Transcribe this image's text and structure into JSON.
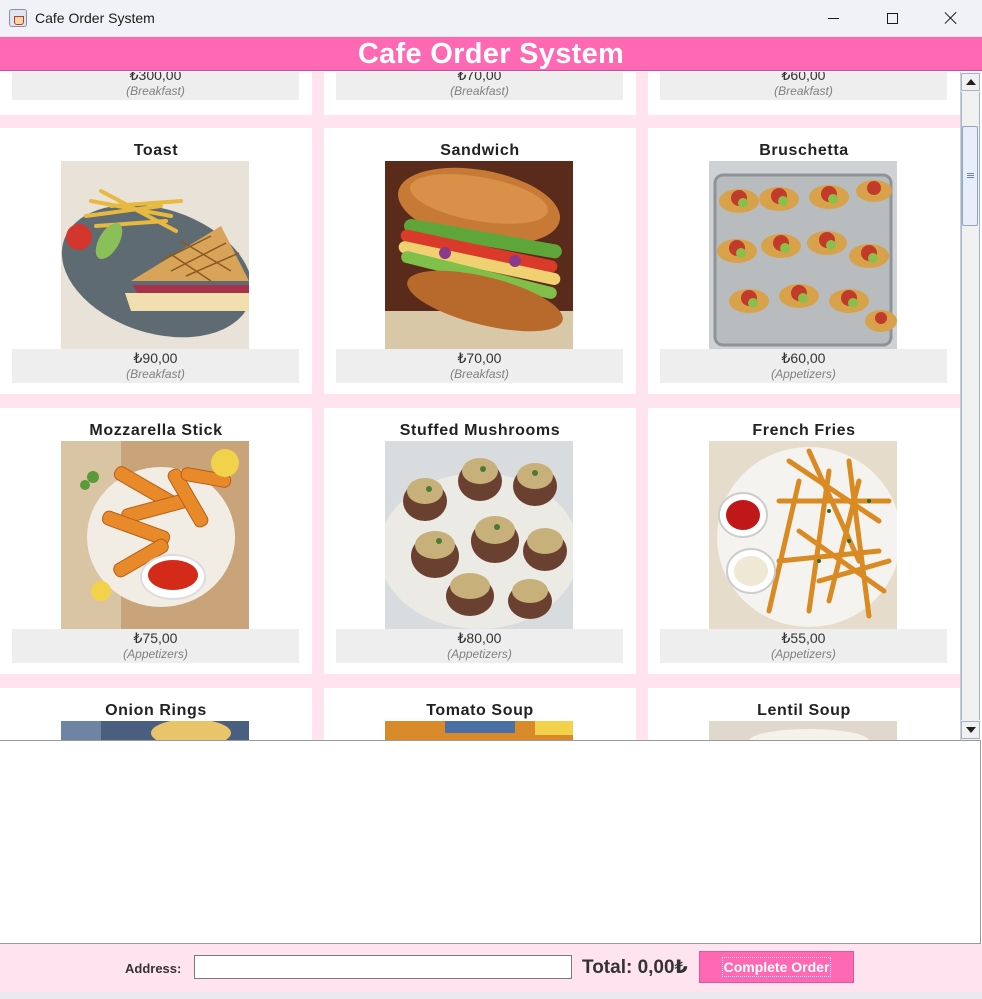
{
  "window": {
    "title": "Cafe Order System",
    "controls": [
      "minimize",
      "maximize",
      "close"
    ]
  },
  "header": {
    "title": "Cafe Order System"
  },
  "menu": {
    "rows": [
      {
        "items": [
          {
            "price": "₺300,00",
            "category": "(Breakfast)"
          },
          {
            "price": "₺70,00",
            "category": "(Breakfast)"
          },
          {
            "price": "₺60,00",
            "category": "(Breakfast)"
          }
        ]
      },
      {
        "items": [
          {
            "name": "Toast",
            "price": "₺90,00",
            "category": "(Breakfast)",
            "image": "toast-photo"
          },
          {
            "name": "Sandwich",
            "price": "₺70,00",
            "category": "(Breakfast)",
            "image": "sandwich-photo"
          },
          {
            "name": "Bruschetta",
            "price": "₺60,00",
            "category": "(Appetizers)",
            "image": "bruschetta-photo"
          }
        ]
      },
      {
        "items": [
          {
            "name": "Mozzarella Stick",
            "price": "₺75,00",
            "category": "(Appetizers)",
            "image": "mozzarella-sticks-photo"
          },
          {
            "name": "Stuffed Mushrooms",
            "price": "₺80,00",
            "category": "(Appetizers)",
            "image": "stuffed-mushrooms-photo"
          },
          {
            "name": "French Fries",
            "price": "₺55,00",
            "category": "(Appetizers)",
            "image": "french-fries-photo"
          }
        ]
      },
      {
        "items": [
          {
            "name": "Onion Rings",
            "image": "onion-rings-photo"
          },
          {
            "name": "Tomato Soup",
            "image": "tomato-soup-photo"
          },
          {
            "name": "Lentil Soup",
            "image": "lentil-soup-photo"
          }
        ]
      }
    ]
  },
  "order": {
    "text": ""
  },
  "footer": {
    "address_label": "Address:",
    "address_value": "",
    "total": "Total: 0,00₺",
    "complete_label": "Complete Order"
  },
  "colors": {
    "accent": "#ff69b4",
    "panel_bg": "#ffe4ef",
    "info_bg": "#eeeeee"
  }
}
